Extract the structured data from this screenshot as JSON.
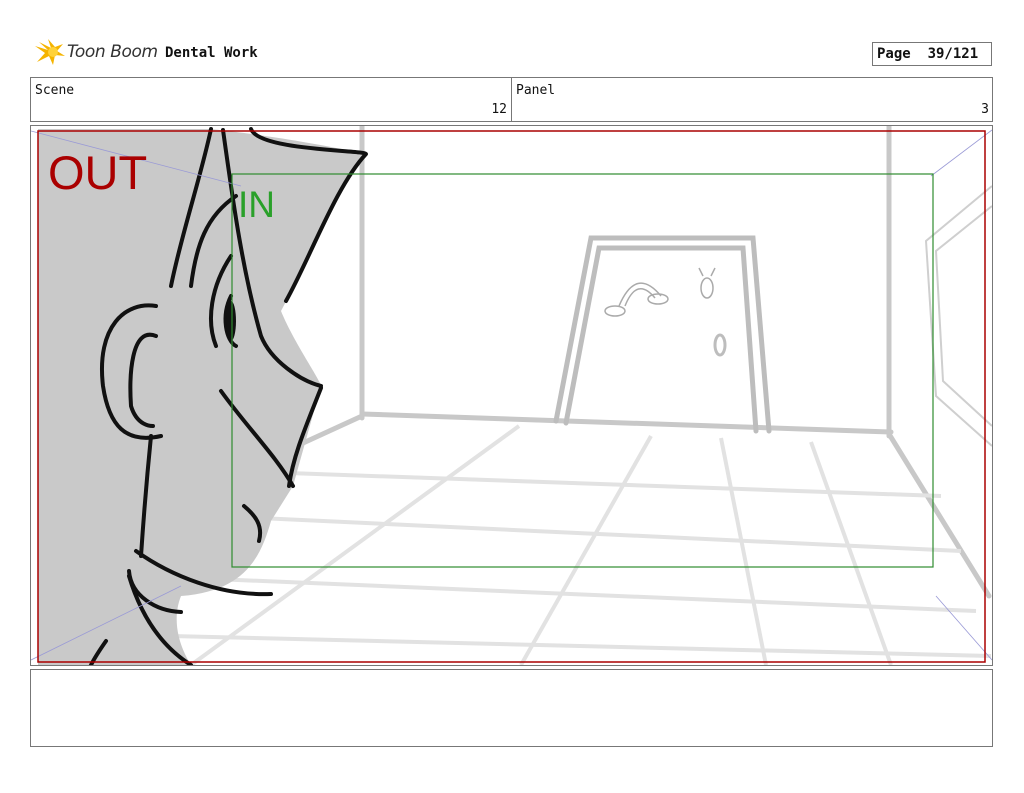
{
  "header": {
    "logo_text": "Toon Boom",
    "project_title": "Dental Work",
    "page_label": "Page",
    "page_number": "39/121"
  },
  "info": {
    "scene_label": "Scene",
    "scene_value": "12",
    "panel_label": "Panel",
    "panel_value": "3"
  },
  "frame": {
    "out_label": "OUT",
    "in_label": "IN",
    "out_color": "#aa0000",
    "in_color": "#2e8b2e"
  },
  "notes": {
    "text": ""
  }
}
